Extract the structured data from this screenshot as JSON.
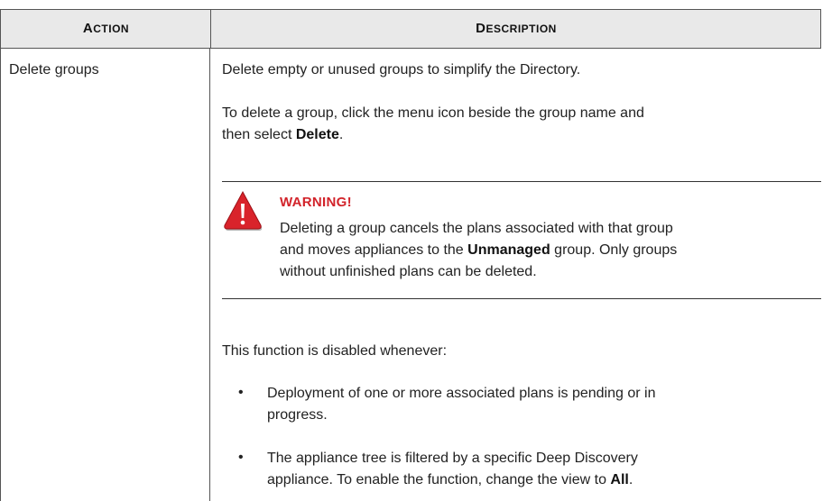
{
  "table": {
    "header": {
      "action": {
        "first": "A",
        "rest": "CTION"
      },
      "description": {
        "first": "D",
        "rest": "ESCRIPTION"
      }
    },
    "row": {
      "action": "Delete groups",
      "desc_intro": "Delete empty or unused groups to simplify the Directory.",
      "delete_instr_a": "To delete a group, click the menu icon beside the group name and",
      "delete_instr_b_pre": "then select ",
      "delete_instr_b_bold": "Delete",
      "delete_instr_b_post": ".",
      "warning": {
        "title": "WARNING!",
        "icon": "warning-triangle-icon",
        "line1": "Deleting a group cancels the plans associated with that group",
        "line2_pre": "and moves appliances to the ",
        "line2_bold": "Unmanaged",
        "line2_post": " group. Only groups",
        "line3": "without unfinished plans can be deleted."
      },
      "disabled_intro": "This function is disabled whenever:",
      "bullets": [
        {
          "line1": "Deployment of one or more associated plans is pending or in",
          "line2": "progress."
        },
        {
          "line1": "The appliance tree is filtered by a specific Deep Discovery",
          "line2_pre": "appliance. To enable the function, change the view to ",
          "line2_bold": "All",
          "line2_post": "."
        }
      ]
    }
  },
  "colors": {
    "warning_red": "#d2232a",
    "header_bg": "#e9e9e9"
  }
}
